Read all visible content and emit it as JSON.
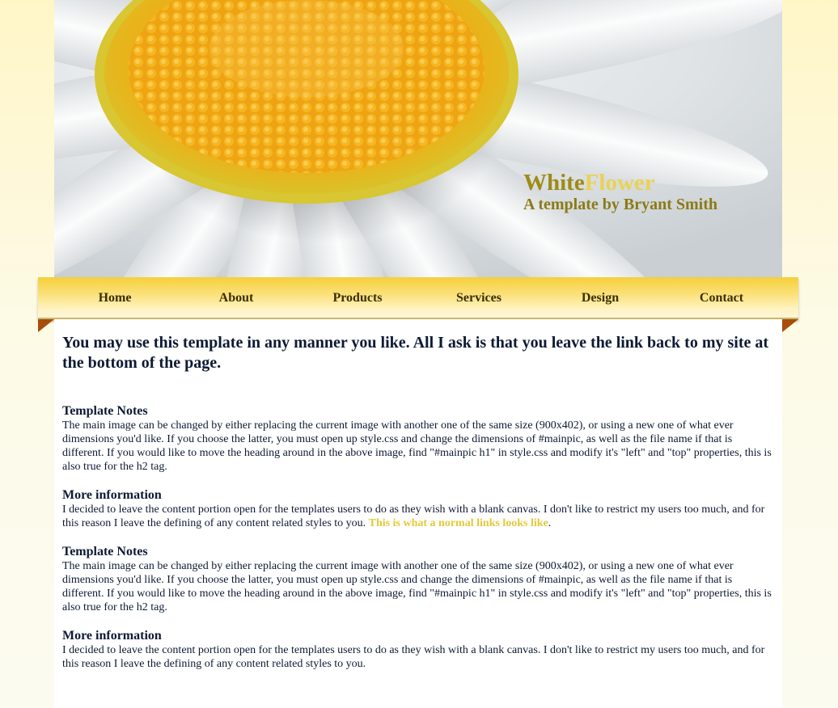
{
  "header": {
    "title_part1": "White",
    "title_part2": "Flower",
    "subtitle": "A template by Bryant Smith"
  },
  "nav": {
    "items": [
      {
        "label": "Home"
      },
      {
        "label": "About"
      },
      {
        "label": "Products"
      },
      {
        "label": "Services"
      },
      {
        "label": "Design"
      },
      {
        "label": "Contact"
      }
    ]
  },
  "content": {
    "heading": "You may use this template in any manner you like. All I ask is that you leave the link back to my site at the bottom of the page.",
    "sections": [
      {
        "title": "Template Notes",
        "text": "The main image can be changed by either replacing the current image with another one of the same size (900x402), or using a new one of what ever dimensions you'd like. If you choose the latter, you must open up style.css and change the dimensions of #mainpic, as well as the file name if that is different. If you would like to move the heading around in the above image, find \"#mainpic h1\" in style.css and modify it's \"left\" and \"top\" properties, this is also true for the h2 tag."
      },
      {
        "title": "More information",
        "text": "I decided to leave the content portion open for the templates users to do as they wish with a blank canvas. I don't like to restrict my users too much, and for this reason I leave the defining of any content related styles to you.",
        "link_text": "This is what a normal links looks like",
        "after_link": "."
      },
      {
        "title": "Template Notes",
        "text": "The main image can be changed by either replacing the current image with another one of the same size (900x402), or using a new one of what ever dimensions you'd like. If you choose the latter, you must open up style.css and change the dimensions of #mainpic, as well as the file name if that is different. If you would like to move the heading around in the above image, find \"#mainpic h1\" in style.css and modify it's \"left\" and \"top\" properties, this is also true for the h2 tag."
      },
      {
        "title": "More information",
        "text": "I decided to leave the content portion open for the templates users to do as they wish with a blank canvas. I don't like to restrict my users too much, and for this reason I leave the defining of any content related styles to you."
      }
    ]
  },
  "colors": {
    "title_dark": "#9e8b16",
    "title_light": "#e9d254",
    "nav_gold": "#f5cf3a",
    "fold_brown": "#a84d0b",
    "link": "#e3c93a",
    "text": "#0d1a33"
  },
  "icons": {
    "header_image": "daisy-flower-photo"
  }
}
